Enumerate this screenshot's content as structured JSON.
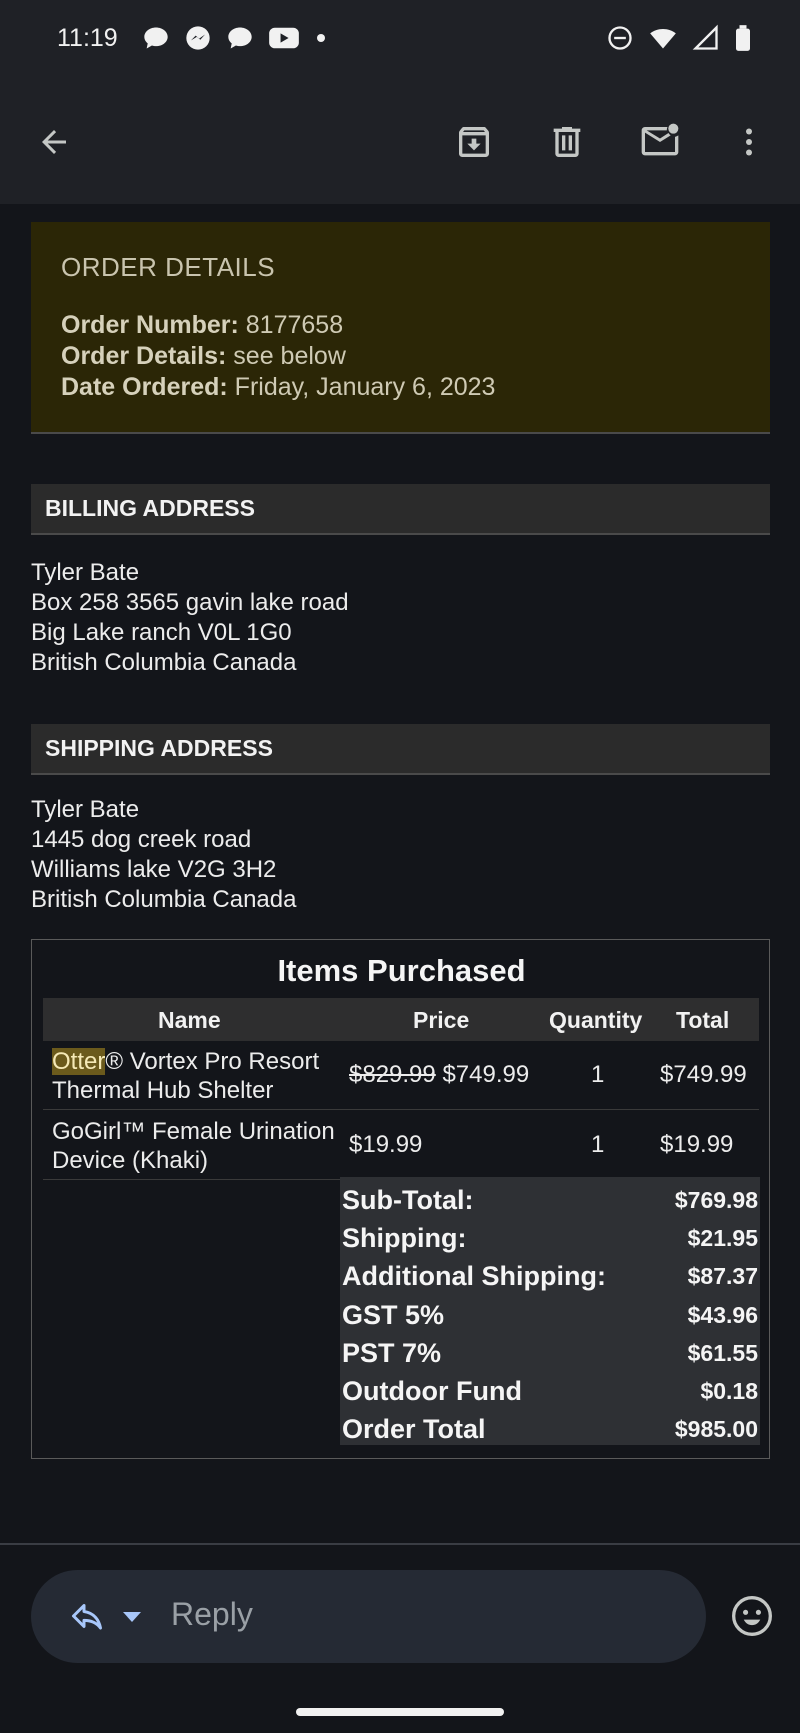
{
  "status_bar": {
    "time": "11:19",
    "left_icons": [
      "chat-bubble-icon",
      "messenger-icon",
      "chat-bubble-icon",
      "youtube-icon",
      "dot-icon"
    ],
    "right_icons": [
      "do-not-disturb-icon",
      "wifi-icon",
      "signal-icon",
      "battery-icon"
    ]
  },
  "app_bar": {
    "actions": [
      "back-arrow-icon",
      "archive-icon",
      "delete-icon",
      "mark-unread-icon",
      "more-vert-icon"
    ]
  },
  "order_details": {
    "heading": "ORDER DETAILS",
    "order_number_label": "Order Number:",
    "order_number": "8177658",
    "order_details_label": "Order Details:",
    "order_details_value": "see below",
    "date_label": "Date Ordered:",
    "date_value": "Friday, January 6, 2023"
  },
  "billing": {
    "heading": "BILLING ADDRESS",
    "lines": [
      "Tyler Bate",
      "Box 258 3565 gavin lake road",
      "Big Lake ranch V0L 1G0",
      "British Columbia Canada"
    ]
  },
  "shipping": {
    "heading": "SHIPPING ADDRESS",
    "lines": [
      "Tyler Bate",
      "1445 dog creek road",
      "Williams lake V2G 3H2",
      "British Columbia Canada"
    ]
  },
  "items": {
    "title": "Items Purchased",
    "columns": [
      "Name",
      "Price",
      "Quantity",
      "Total"
    ],
    "rows": [
      {
        "name_highlight": "Otter",
        "name_rest": "® Vortex Pro Resort Thermal Hub Shelter",
        "old_price": "$829.99",
        "price": "$749.99",
        "quantity": "1",
        "total": "$749.99"
      },
      {
        "name_highlight": "",
        "name_rest": "GoGirl™ Female Urination Device (Khaki)",
        "old_price": "",
        "price": "$19.99",
        "quantity": "1",
        "total": "$19.99"
      }
    ],
    "totals": [
      {
        "label": "Sub-Total:",
        "value": "$769.98"
      },
      {
        "label": "Shipping:",
        "value": "$21.95"
      },
      {
        "label": "Additional Shipping:",
        "value": "$87.37"
      },
      {
        "label": "GST 5%",
        "value": "$43.96"
      },
      {
        "label": "PST 7%",
        "value": "$61.55"
      },
      {
        "label": "Outdoor Fund",
        "value": "$0.18"
      },
      {
        "label": "Order Total",
        "value": "$985.00"
      }
    ]
  },
  "reply_bar": {
    "placeholder": "Reply"
  }
}
